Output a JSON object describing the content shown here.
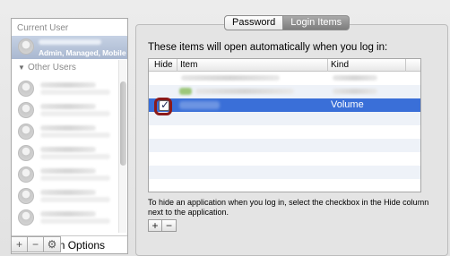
{
  "sidebar": {
    "current_user_header": "Current User",
    "current_user_role": "Admin, Managed, Mobile",
    "other_users_header": "Other Users",
    "other_users_count": 7,
    "login_options_label": "Login Options",
    "buttons": [
      "+",
      "−",
      "⚙"
    ]
  },
  "tabs": [
    {
      "label": "Password",
      "active": false
    },
    {
      "label": "Login Items",
      "active": true
    }
  ],
  "panel": {
    "title": "These items will open automatically when you log in:",
    "columns": [
      "Hide",
      "Item",
      "Kind"
    ],
    "rows": [
      {
        "hide": false,
        "item": "",
        "kind": "",
        "selected": false
      },
      {
        "hide": false,
        "item": "",
        "kind": "",
        "selected": false
      },
      {
        "hide": true,
        "item": "",
        "kind": "Volume",
        "selected": true
      },
      {
        "hide": false,
        "item": "",
        "kind": "",
        "selected": false
      },
      {
        "hide": false,
        "item": "",
        "kind": "",
        "selected": false
      },
      {
        "hide": false,
        "item": "",
        "kind": "",
        "selected": false
      },
      {
        "hide": false,
        "item": "",
        "kind": "",
        "selected": false
      },
      {
        "hide": false,
        "item": "",
        "kind": "",
        "selected": false
      },
      {
        "hide": false,
        "item": "",
        "kind": "",
        "selected": false
      }
    ],
    "hint": "To hide an application when you log in, select the checkbox in the Hide column next to the application.",
    "add_label": "+",
    "remove_label": "−"
  },
  "colors": {
    "selection": "#3a6fd8",
    "highlight_ring": "#8b1a1a",
    "current_user_bg": "#b4c2d8"
  }
}
